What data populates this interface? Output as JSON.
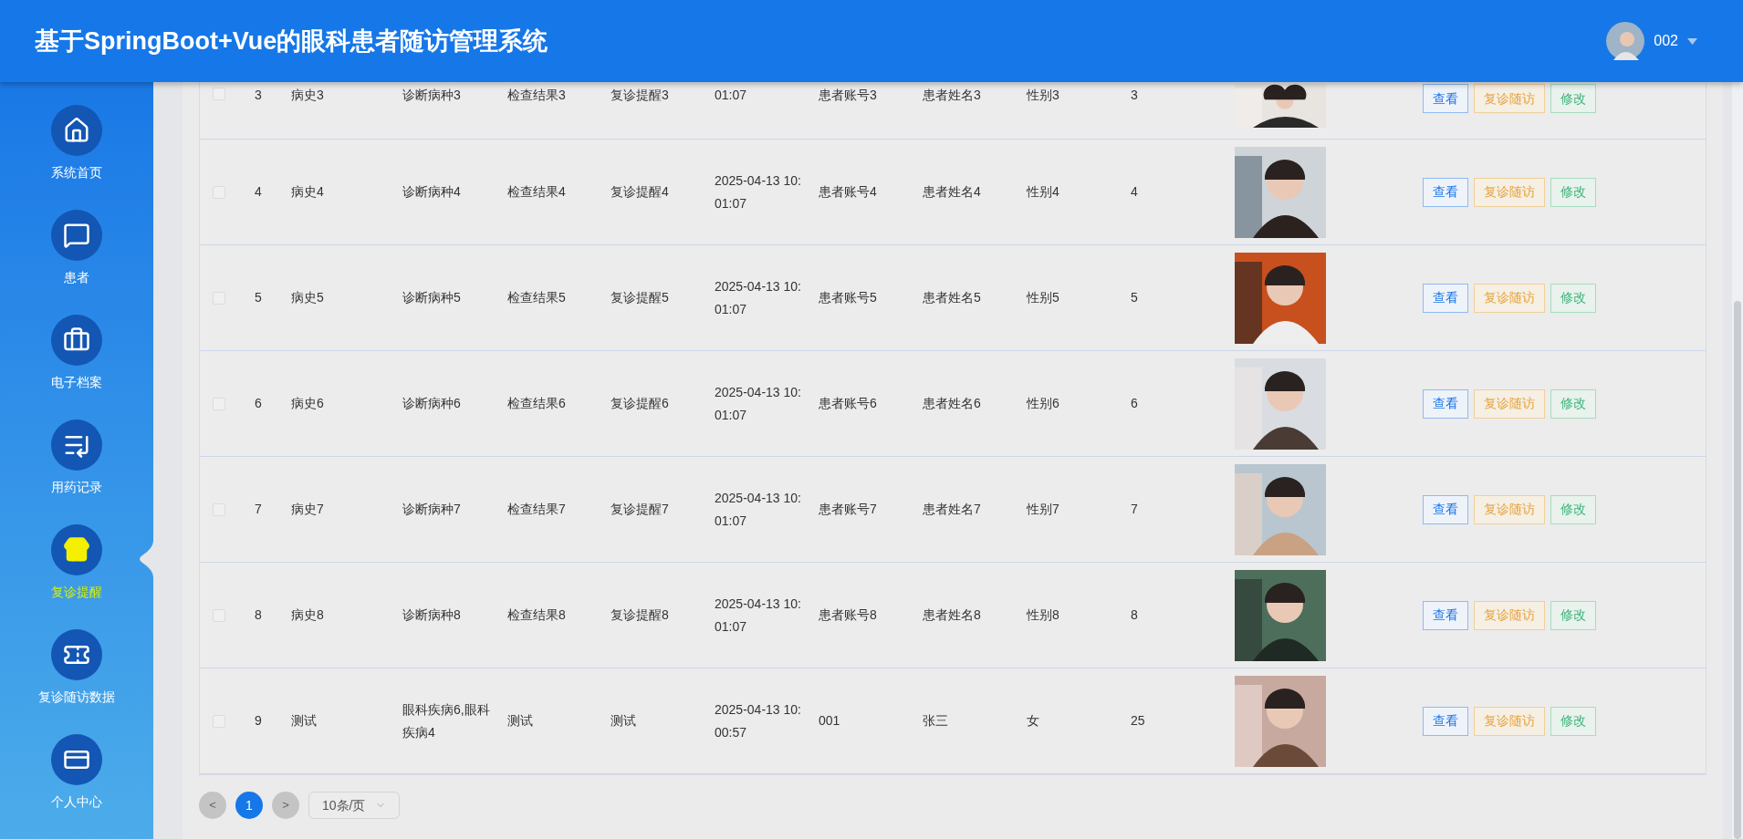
{
  "header": {
    "title": "基于SpringBoot+Vue的眼科患者随访管理系统",
    "user": "002"
  },
  "sidebar": {
    "items": [
      {
        "label": "系统首页",
        "selected": false
      },
      {
        "label": "患者",
        "selected": false
      },
      {
        "label": "电子档案",
        "selected": false
      },
      {
        "label": "用药记录",
        "selected": false
      },
      {
        "label": "复诊提醒",
        "selected": true
      },
      {
        "label": "复诊随访数据",
        "selected": false
      },
      {
        "label": "个人中心",
        "selected": false
      }
    ]
  },
  "table": {
    "rows": [
      {
        "cut": true,
        "checked": false,
        "cells": [
          "3",
          "病史3",
          "诊断病种3",
          "检查结果3",
          "复诊提醒3",
          "01:07",
          "患者账号3",
          "患者姓名3",
          "性别3",
          "3"
        ],
        "actions": [
          "查看",
          "复诊随访",
          "修改"
        ]
      },
      {
        "cut": false,
        "checked": false,
        "cells": [
          "4",
          "病史4",
          "诊断病种4",
          "检查结果4",
          "复诊提醒4",
          "2025-04-13 10:01:07",
          "患者账号4",
          "患者姓名4",
          "性别4",
          "4"
        ],
        "actions": [
          "查看",
          "复诊随访",
          "修改"
        ]
      },
      {
        "cut": false,
        "checked": false,
        "cells": [
          "5",
          "病史5",
          "诊断病种5",
          "检查结果5",
          "复诊提醒5",
          "2025-04-13 10:01:07",
          "患者账号5",
          "患者姓名5",
          "性别5",
          "5"
        ],
        "actions": [
          "查看",
          "复诊随访",
          "修改"
        ]
      },
      {
        "cut": false,
        "checked": false,
        "cells": [
          "6",
          "病史6",
          "诊断病种6",
          "检查结果6",
          "复诊提醒6",
          "2025-04-13 10:01:07",
          "患者账号6",
          "患者姓名6",
          "性别6",
          "6"
        ],
        "actions": [
          "查看",
          "复诊随访",
          "修改"
        ]
      },
      {
        "cut": false,
        "checked": false,
        "cells": [
          "7",
          "病史7",
          "诊断病种7",
          "检查结果7",
          "复诊提醒7",
          "2025-04-13 10:01:07",
          "患者账号7",
          "患者姓名7",
          "性别7",
          "7"
        ],
        "actions": [
          "查看",
          "复诊随访",
          "修改"
        ]
      },
      {
        "cut": false,
        "checked": false,
        "cells": [
          "8",
          "病史8",
          "诊断病种8",
          "检查结果8",
          "复诊提醒8",
          "2025-04-13 10:01:07",
          "患者账号8",
          "患者姓名8",
          "性别8",
          "8"
        ],
        "actions": [
          "查看",
          "复诊随访",
          "修改"
        ]
      },
      {
        "cut": false,
        "checked": false,
        "cells": [
          "9",
          "测试",
          "眼科疾病6,眼科疾病4",
          "测试",
          "测试",
          "2025-04-13 10:00:57",
          "001",
          "张三",
          "女",
          "25"
        ],
        "actions": [
          "查看",
          "复诊随访",
          "修改"
        ]
      }
    ]
  },
  "pagination": {
    "prev": "<",
    "pages": [
      {
        "label": "1",
        "selected": true
      }
    ],
    "next": ">",
    "page_size": "10条/页"
  }
}
